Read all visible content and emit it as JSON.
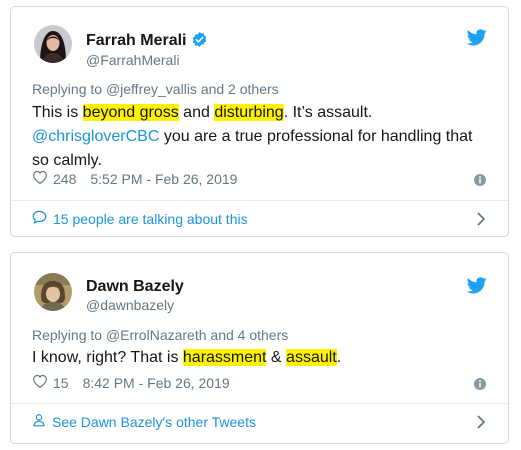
{
  "colors": {
    "link": "#1b95e0",
    "muted": "#657786",
    "highlight": "#fff200",
    "border": "#cfd9de"
  },
  "tweets": [
    {
      "name": "Farrah Merali",
      "handle": "@FarrahMerali",
      "verified": true,
      "reply_prefix": "Replying to ",
      "reply_users": "@jeffrey_vallis and 2 others",
      "body": {
        "t1": "This is ",
        "h1": "beyond gross",
        "t2": " and ",
        "h2": "disturbing",
        "t3": ". It’s assault. ",
        "mention": "@chrisgloverCBC",
        "t4": " you are a true professional for handling that so calmly."
      },
      "likes": "248",
      "timestamp": "5:52 PM - Feb 26, 2019",
      "footer": "15 people are talking about this",
      "icons": {
        "logo": "twitter-bird-icon",
        "footer": "speech-bubble-icon"
      }
    },
    {
      "name": "Dawn Bazely",
      "handle": "@dawnbazely",
      "verified": false,
      "reply_prefix": "Replying to ",
      "reply_users": "@ErrolNazareth and 4 others",
      "body": {
        "t1": "I know, right? That is ",
        "h1": "harassment",
        "t2": " & ",
        "h2": "assault",
        "t3": "."
      },
      "likes": "15",
      "timestamp": "8:42 PM - Feb 26, 2019",
      "footer": "See Dawn Bazely's other Tweets",
      "icons": {
        "logo": "twitter-bird-icon",
        "footer": "person-icon"
      }
    }
  ]
}
